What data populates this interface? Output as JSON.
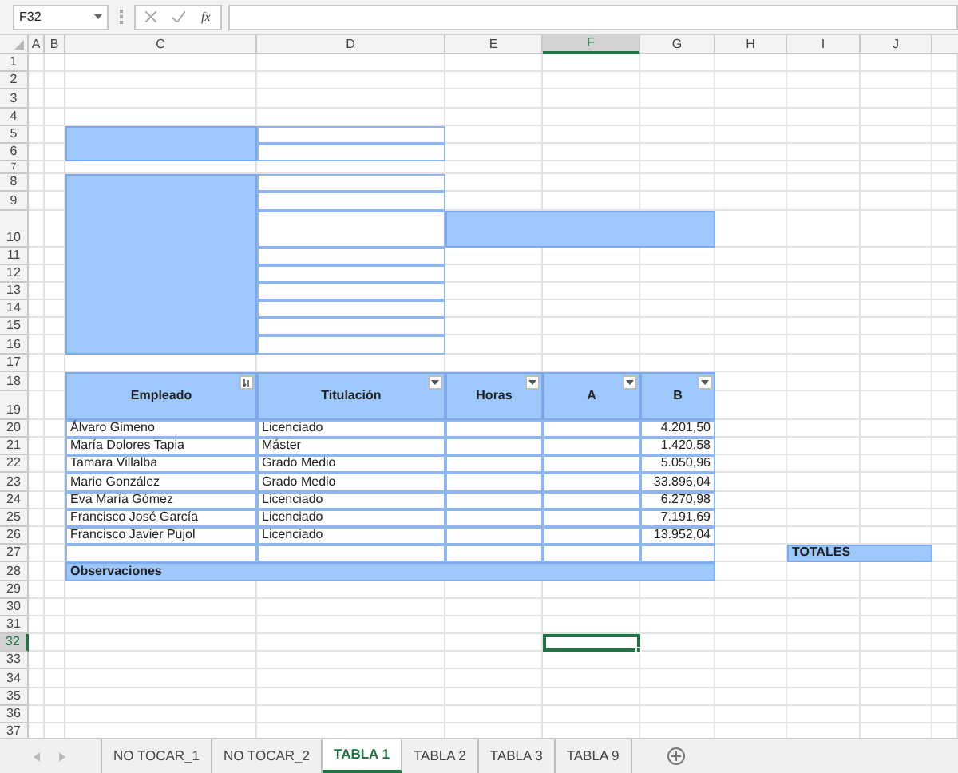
{
  "name_box": {
    "value": "F32"
  },
  "formula_bar": {
    "function_label": "fx"
  },
  "columns": [
    {
      "label": "A",
      "selected": false
    },
    {
      "label": "B",
      "selected": false
    },
    {
      "label": "C",
      "selected": false
    },
    {
      "label": "D",
      "selected": false
    },
    {
      "label": "E",
      "selected": false
    },
    {
      "label": "F",
      "selected": true
    },
    {
      "label": "G",
      "selected": false
    },
    {
      "label": "H",
      "selected": false
    },
    {
      "label": "I",
      "selected": false
    },
    {
      "label": "J",
      "selected": false
    }
  ],
  "rows": [
    {
      "label": "1",
      "selected": false
    },
    {
      "label": "2",
      "selected": false
    },
    {
      "label": "3",
      "selected": false
    },
    {
      "label": "4",
      "selected": false
    },
    {
      "label": "5",
      "selected": false
    },
    {
      "label": "6",
      "selected": false
    },
    {
      "label": "7",
      "selected": false
    },
    {
      "label": "8",
      "selected": false
    },
    {
      "label": "9",
      "selected": false
    },
    {
      "label": "10",
      "selected": false
    },
    {
      "label": "11",
      "selected": false
    },
    {
      "label": "12",
      "selected": false
    },
    {
      "label": "13",
      "selected": false
    },
    {
      "label": "14",
      "selected": false
    },
    {
      "label": "15",
      "selected": false
    },
    {
      "label": "16",
      "selected": false
    },
    {
      "label": "17",
      "selected": false
    },
    {
      "label": "18",
      "selected": false
    },
    {
      "label": "19",
      "selected": false
    },
    {
      "label": "20",
      "selected": false
    },
    {
      "label": "21",
      "selected": false
    },
    {
      "label": "22",
      "selected": false
    },
    {
      "label": "23",
      "selected": false
    },
    {
      "label": "24",
      "selected": false
    },
    {
      "label": "25",
      "selected": false
    },
    {
      "label": "26",
      "selected": false
    },
    {
      "label": "27",
      "selected": false
    },
    {
      "label": "28",
      "selected": false
    },
    {
      "label": "29",
      "selected": false
    },
    {
      "label": "30",
      "selected": false
    },
    {
      "label": "31",
      "selected": false
    },
    {
      "label": "32",
      "selected": true
    },
    {
      "label": "33",
      "selected": false
    },
    {
      "label": "34",
      "selected": false
    },
    {
      "label": "35",
      "selected": false
    },
    {
      "label": "36",
      "selected": false
    },
    {
      "label": "37",
      "selected": false
    }
  ],
  "table": {
    "headers": [
      {
        "label": "Empleado",
        "sorted": true
      },
      {
        "label": "Titulación",
        "sorted": false
      },
      {
        "label": "Horas",
        "sorted": false
      },
      {
        "label": "A",
        "sorted": false
      },
      {
        "label": "B",
        "sorted": false
      }
    ],
    "rows": [
      {
        "empleado": "Álvaro Gimeno",
        "titulacion": "Licenciado",
        "b": "4.201,50"
      },
      {
        "empleado": "María Dolores Tapia",
        "titulacion": "Máster",
        "b": "1.420,58"
      },
      {
        "empleado": "Tamara Villalba",
        "titulacion": "Grado Medio",
        "b": "5.050,96"
      },
      {
        "empleado": "Mario González",
        "titulacion": "Grado Medio",
        "b": "33.896,04"
      },
      {
        "empleado": "Eva María Gómez",
        "titulacion": "Licenciado",
        "b": "6.270,98"
      },
      {
        "empleado": "Francisco José García",
        "titulacion": "Licenciado",
        "b": "7.191,69"
      },
      {
        "empleado": "Francisco Javier Pujol",
        "titulacion": "Licenciado",
        "b": "13.952,04"
      }
    ],
    "footer_label": "Observaciones"
  },
  "totales_label": "TOTALES",
  "sheet_tabs": [
    {
      "label": "NO TOCAR_1",
      "selected": false
    },
    {
      "label": "NO TOCAR_2",
      "selected": false
    },
    {
      "label": "TABLA 1",
      "selected": true
    },
    {
      "label": "TABLA 2",
      "selected": false
    },
    {
      "label": "TABLA 3",
      "selected": false
    },
    {
      "label": "TABLA 9",
      "selected": false
    }
  ]
}
